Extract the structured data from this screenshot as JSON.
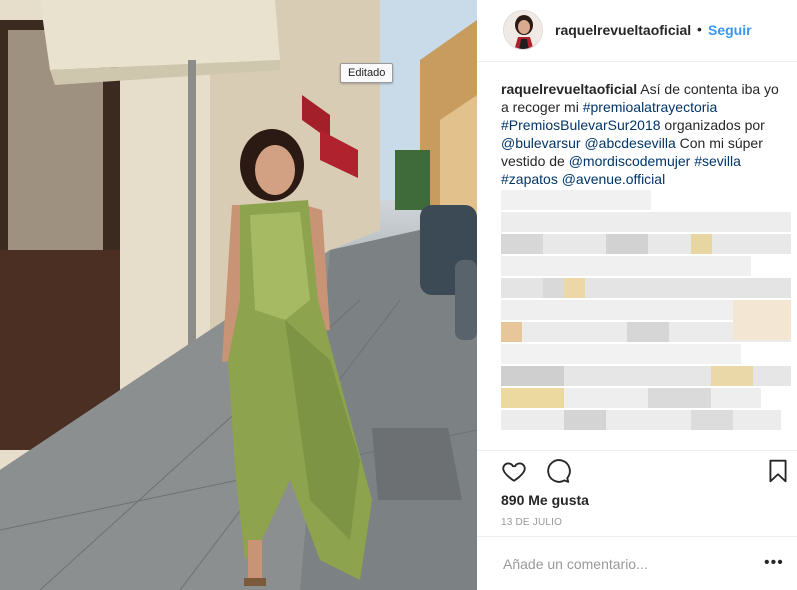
{
  "tooltip": "Editado",
  "post": {
    "username": "raquelrevueltaoficial",
    "separator": "•",
    "follow_label": "Seguir",
    "caption": {
      "author": "raquelrevueltaoficial",
      "text_1": " Así de contenta iba yo a recoger mi ",
      "tag_1": "#premioalatrayectoria",
      "space_1": " ",
      "tag_2": "#PremiosBulevarSur2018",
      "text_2": " organizados por ",
      "mention_1": "@bulevarsur",
      "space_2": " ",
      "mention_2": "@abcdesevilla",
      "text_3": " Con mi súper vestido de ",
      "mention_3": "@mordiscodemujer",
      "space_3": " ",
      "tag_3": "#sevilla",
      "space_4": " ",
      "tag_4": "#zapatos",
      "space_5": " ",
      "mention_4": "@avenue.official"
    },
    "likes": "890 Me gusta",
    "date": "13 DE JULIO",
    "comment_placeholder": "Añade un comentario...",
    "more_label": "•••"
  },
  "icons": {
    "like": "heart-outline-icon",
    "comment": "comment-bubble-icon",
    "save": "bookmark-icon",
    "more": "more-options-icon"
  },
  "colors": {
    "link": "#003569",
    "follow": "#3897f0",
    "muted": "#999999",
    "divider": "#efefef"
  }
}
